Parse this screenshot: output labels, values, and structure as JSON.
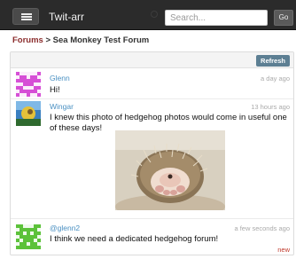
{
  "nav": {
    "menu_icon": "hamburger-menu-icon",
    "brand": "Twit-arr",
    "search_placeholder": "Search...",
    "go_label": "Go"
  },
  "breadcrumb": {
    "forums": "Forums",
    "separator": " > ",
    "current": "Sea Monkey Test Forum"
  },
  "toolbar": {
    "refresh_label": "Refresh"
  },
  "posts": [
    {
      "author": "Glenn",
      "timestamp": "a day ago",
      "text": "Hi!",
      "avatar_color": "#d64fd6"
    },
    {
      "author": "Wingar",
      "timestamp": "13 hours ago",
      "text": "I knew this photo of hedgehog photos would come in useful one of these days!",
      "has_photo": true
    },
    {
      "author": "@glenn2",
      "timestamp": "a few seconds ago",
      "text": "I think we need a dedicated hedgehog forum!",
      "badge": "new",
      "avatar_color": "#5cc23a"
    }
  ],
  "colors": {
    "navbar": "#2b2b2b",
    "link": "#4a90c2",
    "breadcrumb_link": "#8b2d2d",
    "refresh": "#5d7f93",
    "badge_new": "#c0392b"
  }
}
